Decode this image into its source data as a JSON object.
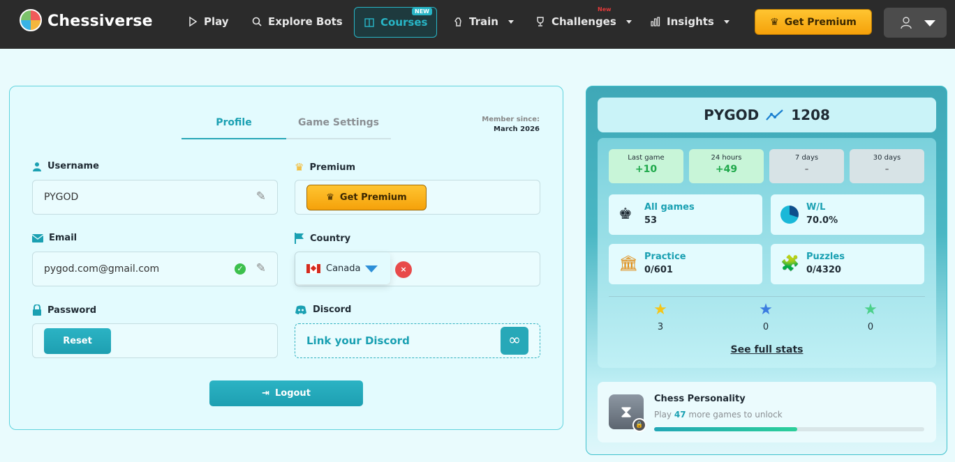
{
  "nav": {
    "brand": "Chessiverse",
    "play": "Play",
    "explore_bots": "Explore Bots",
    "courses": "Courses",
    "courses_badge": "NEW",
    "train": "Train",
    "challenges": "Challenges",
    "challenges_badge": "New",
    "insights": "Insights",
    "get_premium": "Get Premium"
  },
  "profile": {
    "tabs": [
      "Profile",
      "Game Settings"
    ],
    "member_since_label": "Member since:",
    "member_since_value": "March 2026",
    "username_label": "Username",
    "username_value": "PYGOD",
    "premium_label": "Premium",
    "premium_button": "Get Premium",
    "email_label": "Email",
    "email_value": "pygod.com@gmail.com",
    "country_label": "Country",
    "country_value": "Canada",
    "password_label": "Password",
    "reset_button": "Reset",
    "discord_label": "Discord",
    "discord_link": "Link your Discord",
    "logout_button": "Logout"
  },
  "stats": {
    "name": "PYGOD",
    "rating": "1208",
    "periods": [
      {
        "label": "Last game",
        "value": "+10",
        "color": "#1ea84a"
      },
      {
        "label": "24 hours",
        "value": "+49",
        "color": "#1ea84a"
      },
      {
        "label": "7 days",
        "value": "-",
        "color": "#8a8f93"
      },
      {
        "label": "30 days",
        "value": "-",
        "color": "#8a8f93"
      }
    ],
    "all_games_label": "All games",
    "all_games_value": "53",
    "wl_label": "W/L",
    "wl_value": "70.0%",
    "practice_label": "Practice",
    "practice_value": "0/601",
    "puzzles_label": "Puzzles",
    "puzzles_value": "0/4320",
    "stars": [
      {
        "icon": "gold-star-icon",
        "count": "3",
        "color": "#f5c518"
      },
      {
        "icon": "blue-star-icon",
        "count": "0",
        "color": "#3b7ce0"
      },
      {
        "icon": "green-star-icon",
        "count": "0",
        "color": "#4cd08a"
      }
    ],
    "see_full_stats": "See full stats",
    "personality_title": "Chess Personality",
    "personality_text_prefix": "Play",
    "personality_games": "47",
    "personality_text_suffix": "more games to unlock",
    "personality_progress": 0.53
  },
  "colors": {
    "accent": "#1aa0b2",
    "premium": "#f5a10a",
    "nav_bg": "#2b2b2b"
  }
}
